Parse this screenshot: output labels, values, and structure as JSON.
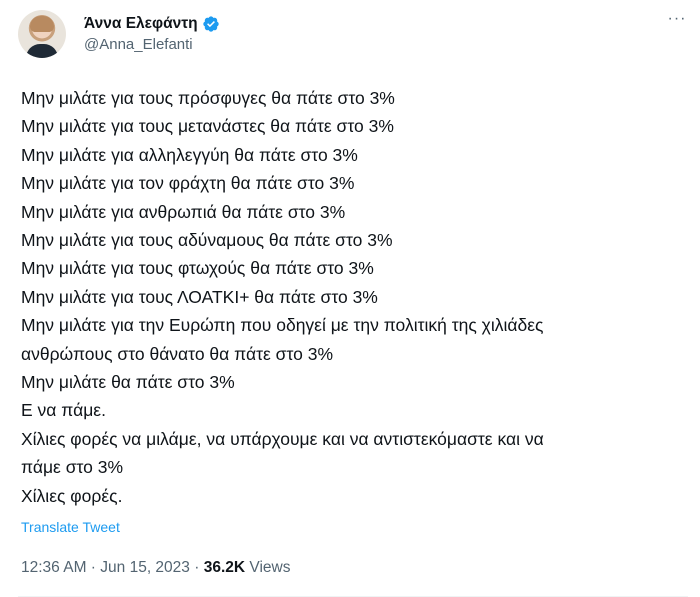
{
  "author": {
    "display_name": "Άννα Ελεφάντη",
    "handle": "@Anna_Elefanti",
    "verified": true,
    "avatar_icon": "avatar-photo"
  },
  "menu": {
    "more_glyph": "···"
  },
  "tweet": {
    "lines": [
      "Μην μιλάτε για τους πρόσφυγες θα πάτε στο 3%",
      "Μην μιλάτε για τους μετανάστες θα πάτε στο 3%",
      "Μην μιλάτε για αλληλεγγύη θα πάτε στο 3%",
      "Μην μιλάτε για τον φράχτη θα πάτε στο 3%",
      "Μην μιλάτε για ανθρωπιά θα πάτε στο 3%",
      "Μην μιλάτε για τους αδύναμους θα πάτε στο 3%",
      "Μην μιλάτε για τους φτωχούς θα πάτε στο 3%",
      "Μην μιλάτε για τους ΛΟΑΤΚΙ+ θα πάτε στο 3%",
      "Μην μιλάτε για την Ευρώπη που οδηγεί με την πολιτική της χιλιάδες",
      "ανθρώπους στο θάνατο θα πάτε στο 3%",
      "Μην μιλάτε θα πάτε στο 3%",
      "Ε να πάμε.",
      "Χίλιες φορές να μιλάμε, να υπάρχουμε και να αντιστεκόμαστε και να",
      "πάμε στο 3%",
      "Χίλιες φορές."
    ],
    "translate_label": "Translate Tweet"
  },
  "meta": {
    "time": "12:36 AM",
    "separator": " · ",
    "date": "Jun 15, 2023",
    "views_count": "36.2K",
    "views_label": " Views"
  },
  "colors": {
    "text": "#0f1419",
    "secondary": "#536471",
    "accent": "#1d9bf0"
  }
}
